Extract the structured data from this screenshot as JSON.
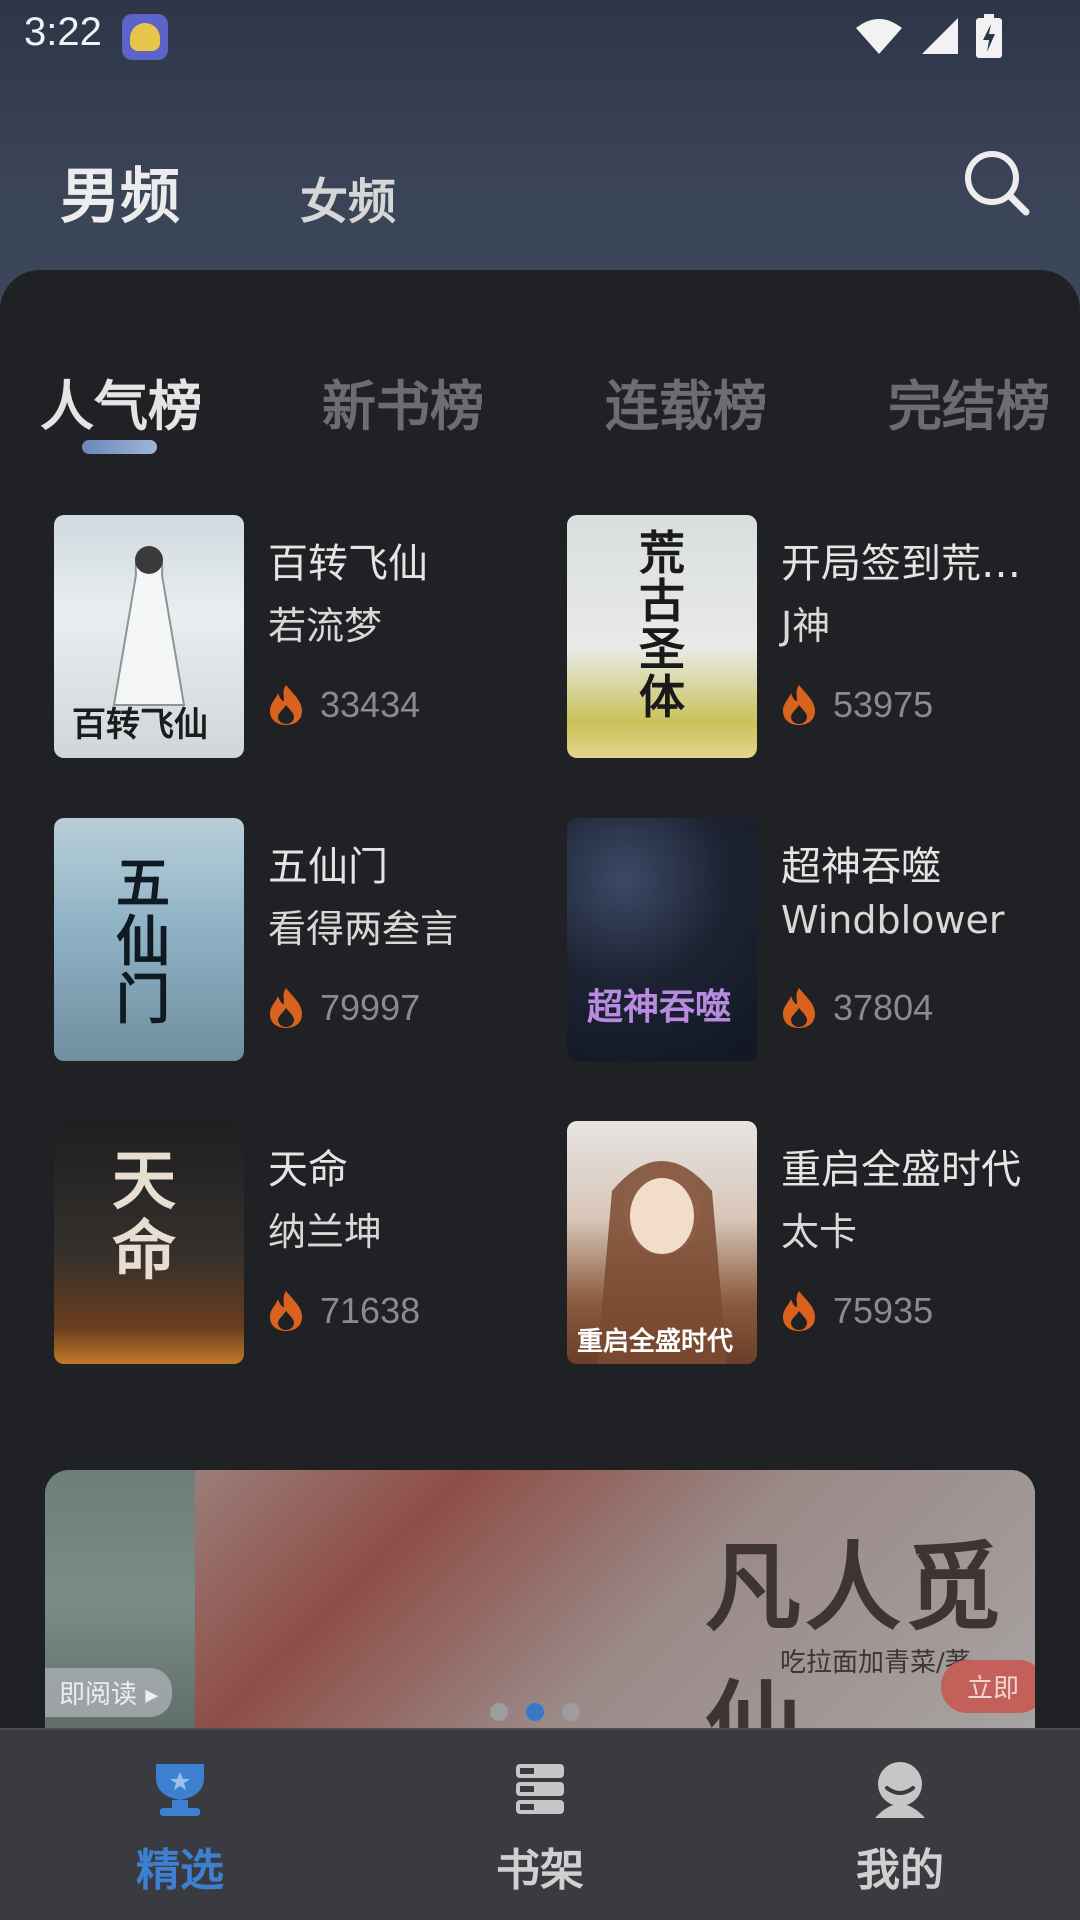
{
  "status": {
    "time": "3:22"
  },
  "channels": [
    {
      "label": "男频"
    },
    {
      "label": "女频"
    }
  ],
  "rank_tabs": [
    {
      "label": "人气榜"
    },
    {
      "label": "新书榜"
    },
    {
      "label": "连载榜"
    },
    {
      "label": "完结榜"
    }
  ],
  "books": [
    {
      "title": "百转飞仙",
      "author": "若流梦",
      "heat": "33434",
      "cover_text": "百转飞仙"
    },
    {
      "title": "开局签到荒…",
      "author": "J神",
      "heat": "53975",
      "cover_text": "荒古圣体"
    },
    {
      "title": "五仙门",
      "author": "看得两叁言",
      "heat": "79997",
      "cover_text": "五仙门"
    },
    {
      "title": "超神吞噬",
      "author": "Windblower",
      "heat": "37804",
      "cover_text": "超神吞噬"
    },
    {
      "title": "天命",
      "author": "纳兰坤",
      "heat": "71638",
      "cover_text": "天命"
    },
    {
      "title": "重启全盛时代",
      "author": "太卡",
      "heat": "75935",
      "cover_text": "重启全盛时代"
    }
  ],
  "banner": {
    "title": "凡人觅仙",
    "subtitle": "吃拉面加青菜/著",
    "read_label": "即阅读 ▸",
    "cta_label": "立即",
    "active_dot": 1
  },
  "bottom_nav": [
    {
      "label": "精选",
      "icon": "trophy-icon"
    },
    {
      "label": "书架",
      "icon": "bookshelf-icon"
    },
    {
      "label": "我的",
      "icon": "profile-icon"
    }
  ],
  "colors": {
    "accent": "#3d7fd0",
    "panel": "#202124",
    "fire": "#d9621f"
  }
}
